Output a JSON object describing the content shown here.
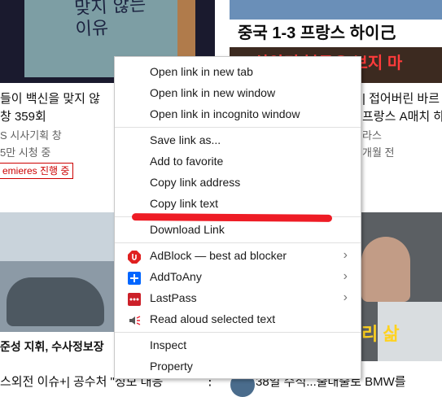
{
  "background": {
    "thumb1_text": "맞지 않는\n이유",
    "thumb2_score": "중국 1-3 프랑스     하이己",
    "thumb2_red": "상암리 북두오 보지 마",
    "thumb3_caption": "준성 지휘, 수사정보장",
    "thumb4_tag": "리 삶",
    "left_line1": "들이 백신을 맞지 않",
    "left_line2": "창 359회",
    "left_line3": "S 시사기획 창",
    "left_line4": "5만 시청 중",
    "left_badge": "emieres 진행 중",
    "right_line1": "| 접어버린 바르",
    "right_line2": "프랑스 A매치 하",
    "right_line3": "라스",
    "right_line4": "개월 전",
    "bottom_left": "스외전 이슈+| 공수처 \"정보 대응",
    "bottom_right": "38일 수석...출대출로 BMW를",
    "more_dots": "⋮"
  },
  "context_menu": {
    "groups": [
      [
        {
          "label": "Open link in new tab",
          "icon": null,
          "submenu": false
        },
        {
          "label": "Open link in new window",
          "icon": null,
          "submenu": false
        },
        {
          "label": "Open link in incognito window",
          "icon": null,
          "submenu": false
        }
      ],
      [
        {
          "label": "Save link as...",
          "icon": null,
          "submenu": false
        },
        {
          "label": "Add to favorite",
          "icon": null,
          "submenu": false
        },
        {
          "label": "Copy link address",
          "icon": null,
          "submenu": false
        },
        {
          "label": "Copy link text",
          "icon": null,
          "submenu": false
        }
      ],
      [
        {
          "label": "Download Link",
          "icon": null,
          "submenu": false
        }
      ],
      [
        {
          "label": "AdBlock — best ad blocker",
          "icon": "adblock-icon",
          "submenu": true
        },
        {
          "label": "AddToAny",
          "icon": "addtoany-icon",
          "submenu": true
        },
        {
          "label": "LastPass",
          "icon": "lastpass-icon",
          "submenu": true
        },
        {
          "label": "Read aloud selected text",
          "icon": "speaker-icon",
          "submenu": false
        }
      ],
      [
        {
          "label": "Inspect",
          "icon": null,
          "submenu": false
        },
        {
          "label": "Property",
          "icon": null,
          "submenu": false
        }
      ]
    ],
    "submenu_glyph": "›"
  },
  "colors": {
    "annotation_red": "#ee1c25",
    "adblock": "#e02020",
    "addtoany": "#0166ff",
    "lastpass": "#cc2029"
  }
}
